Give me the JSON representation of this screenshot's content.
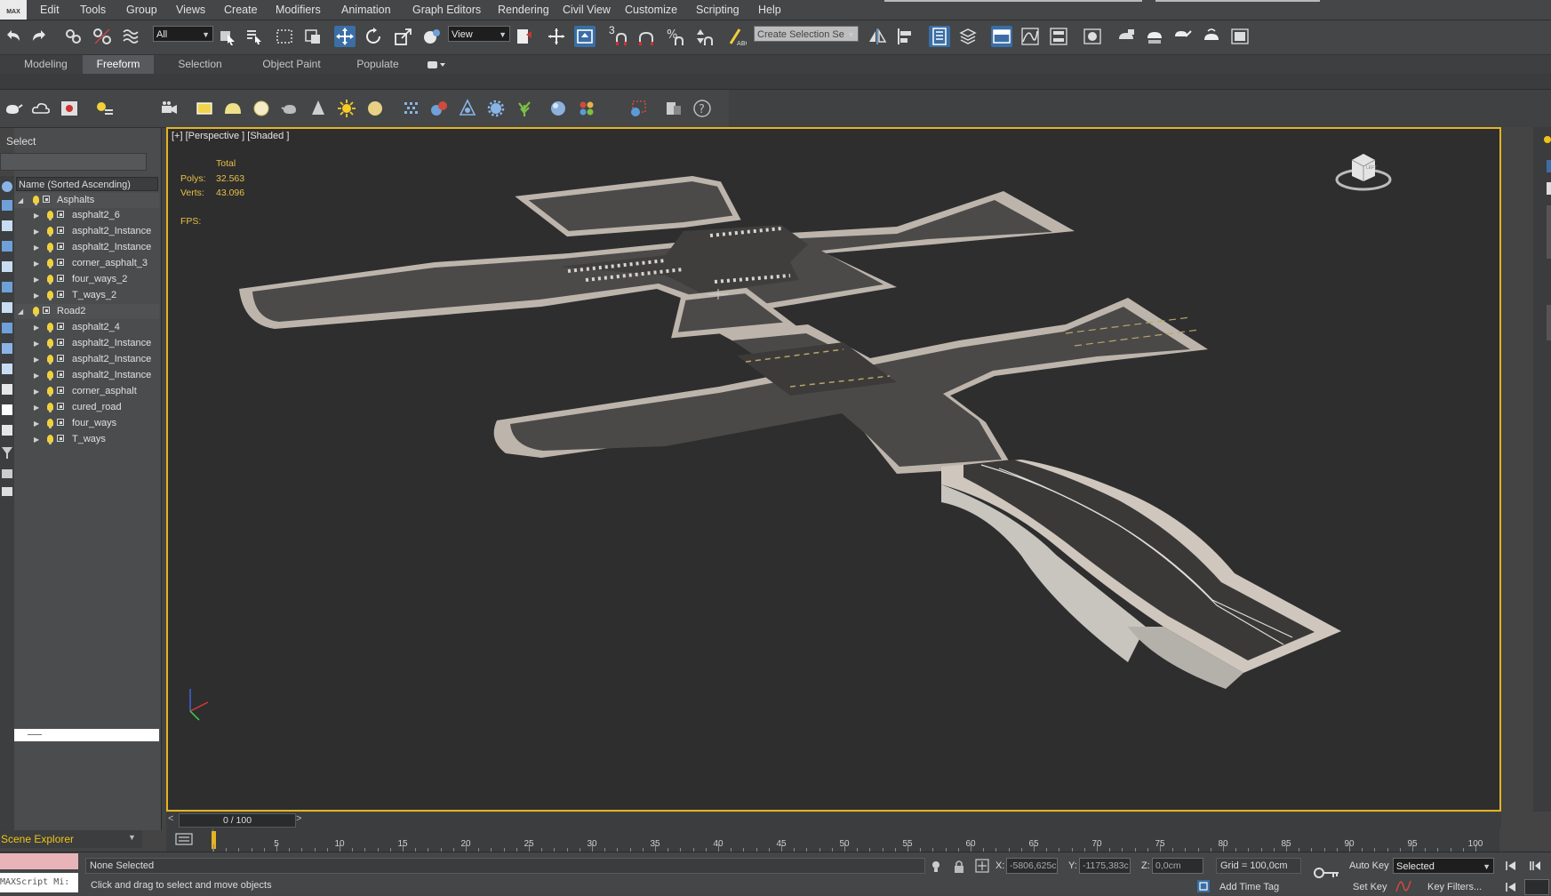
{
  "menubar": {
    "logo": "MAX",
    "items": [
      "Edit",
      "Tools",
      "Group",
      "Views",
      "Create",
      "Modifiers",
      "Animation",
      "Graph Editors",
      "Rendering",
      "Civil View",
      "Customize",
      "Scripting",
      "Help"
    ]
  },
  "toolbar": {
    "filter_value": "All",
    "refcoord_value": "View",
    "selection_set_placeholder": "Create Selection Se",
    "snaps_label": "3"
  },
  "ribbon": {
    "tabs": [
      "Modeling",
      "Freeform",
      "Selection",
      "Object Paint",
      "Populate"
    ],
    "active_tab": "Freeform"
  },
  "explorer": {
    "select_label": "Select",
    "column_header": "Name (Sorted Ascending)",
    "groups": [
      {
        "name": "Asphalts",
        "children": [
          "asphalt2_6",
          "asphalt2_Instance",
          "asphalt2_Instance",
          "corner_asphalt_3",
          "four_ways_2",
          "T_ways_2"
        ]
      },
      {
        "name": "Road2",
        "children": [
          "asphalt2_4",
          "asphalt2_Instance",
          "asphalt2_Instance",
          "asphalt2_Instance",
          "corner_asphalt",
          "cured_road",
          "four_ways",
          "T_ways"
        ]
      }
    ],
    "footer_label": "Scene Explorer"
  },
  "viewport": {
    "label": "[+] [Perspective ] [Shaded ]",
    "stats": {
      "total_label": "Total",
      "polys_label": "Polys:",
      "polys_value": "32.563",
      "verts_label": "Verts:",
      "verts_value": "43.096",
      "fps_label": "FPS:"
    },
    "border_color": "#e4b422",
    "viewcube_face": "LEFT"
  },
  "timeslider": {
    "value": "0 / 100",
    "prev": "<",
    "next": ">"
  },
  "trackbar": {
    "ticks": [
      "0",
      "5",
      "10",
      "15",
      "20",
      "25",
      "30",
      "35",
      "40",
      "45",
      "50",
      "55",
      "60",
      "65",
      "70",
      "75",
      "80",
      "85",
      "90",
      "95",
      "100"
    ]
  },
  "statusbar": {
    "maxscript_label": "MAXScript Mi:",
    "selection_status": "None Selected",
    "prompt": "Click and drag to select and move objects",
    "x_label": "X:",
    "x_value": "-5806,625c",
    "y_label": "Y:",
    "y_value": "-1175,383c",
    "z_label": "Z:",
    "z_value": "0,0cm",
    "grid": "Grid = 100,0cm",
    "add_time_tag": "Add Time Tag",
    "auto_key": "Auto Key",
    "set_key": "Set Key",
    "key_mode_value": "Selected",
    "key_filters": "Key Filters..."
  },
  "colors": {
    "accent_blue": "#3a6ea5",
    "viewport_bg": "#2e2e2f",
    "stats_yellow": "#e6c045",
    "scene_explorer_label": "#f0c414"
  }
}
